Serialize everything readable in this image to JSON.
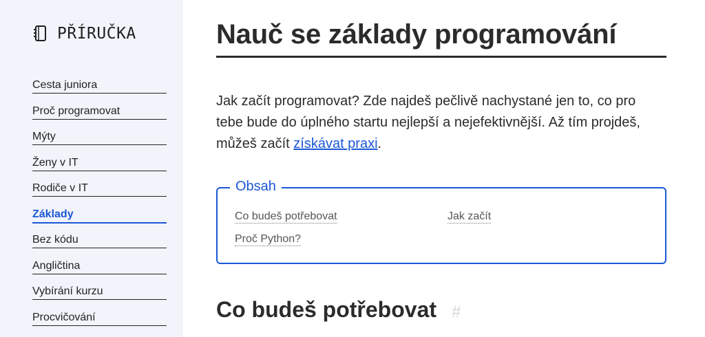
{
  "brand": {
    "icon": "notebook-icon",
    "title": "PŘÍRUČKA"
  },
  "nav": {
    "items": [
      {
        "label": "Cesta juniora"
      },
      {
        "label": "Proč programovat"
      },
      {
        "label": "Mýty"
      },
      {
        "label": "Ženy v IT"
      },
      {
        "label": "Rodiče v IT"
      },
      {
        "label": "Základy",
        "active": true
      },
      {
        "label": "Bez kódu"
      },
      {
        "label": "Angličtina"
      },
      {
        "label": "Vybírání kurzu"
      },
      {
        "label": "Procvičování"
      }
    ]
  },
  "main": {
    "title": "Nauč se základy programování",
    "lead_text": "Jak začít programovat? Zde najdeš pečlivě nachystané jen to, co pro tebe bude do úplného startu nejlepší a nejefektivnější. Až tím projdeš, můžeš začít ",
    "lead_link": "získávat praxi",
    "lead_end": ".",
    "toc": {
      "legend": "Obsah",
      "links": [
        "Co budeš potřebovat",
        "Jak začít",
        "Proč Python?"
      ]
    },
    "section_heading": "Co budeš potřebovat",
    "section_anchor": "#"
  },
  "colors": {
    "accent": "#1a57d6",
    "sidebar_bg": "#f1f4fa",
    "text": "#2b2b2b"
  }
}
